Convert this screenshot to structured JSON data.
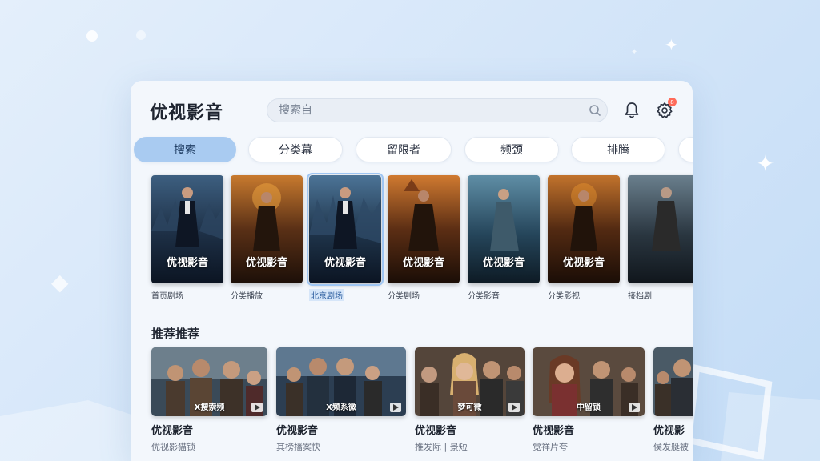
{
  "app": {
    "title": "优视影音"
  },
  "search": {
    "placeholder": "搜索自"
  },
  "header": {
    "notification_badge": "8"
  },
  "tabs": [
    {
      "label": "搜索",
      "active": true
    },
    {
      "label": "分类幕",
      "active": false
    },
    {
      "label": "留限者",
      "active": false
    },
    {
      "label": "频颈",
      "active": false
    },
    {
      "label": "排腾",
      "active": false
    },
    {
      "label": "",
      "active": false
    }
  ],
  "posters": [
    {
      "title": "优视影音",
      "caption": "首页剧场",
      "selected": false,
      "palette": "blue"
    },
    {
      "title": "优视影音",
      "caption": "分类播放",
      "selected": false,
      "palette": "orange"
    },
    {
      "title": "优视影音",
      "caption": "北京剧场",
      "selected": true,
      "palette": "blue"
    },
    {
      "title": "优视影音",
      "caption": "分类剧场",
      "selected": false,
      "palette": "orange"
    },
    {
      "title": "优视影音",
      "caption": "分类影音",
      "selected": false,
      "palette": "teal"
    },
    {
      "title": "优视影音",
      "caption": "分类影视",
      "selected": false,
      "palette": "orange"
    },
    {
      "title": "",
      "caption": "接档剧",
      "selected": false,
      "palette": "gray"
    }
  ],
  "recommend": {
    "title": "推荐推荐",
    "items": [
      {
        "title": "优视影音",
        "subtitle": "优视影猫锁",
        "logo": "X搜索频"
      },
      {
        "title": "优视影音",
        "subtitle": "其榜播案快",
        "logo": "X频系微"
      },
      {
        "title": "优视影音",
        "subtitle": "推发际 | 景短",
        "logo": "梦可微"
      },
      {
        "title": "优视影音",
        "subtitle": "觉祥片夸",
        "logo": "中留锁"
      },
      {
        "title": "优视影",
        "subtitle": "侯发艇被",
        "logo": ""
      }
    ]
  },
  "colors": {
    "accent": "#a9cbf1",
    "badge": "#ff6b5a"
  }
}
